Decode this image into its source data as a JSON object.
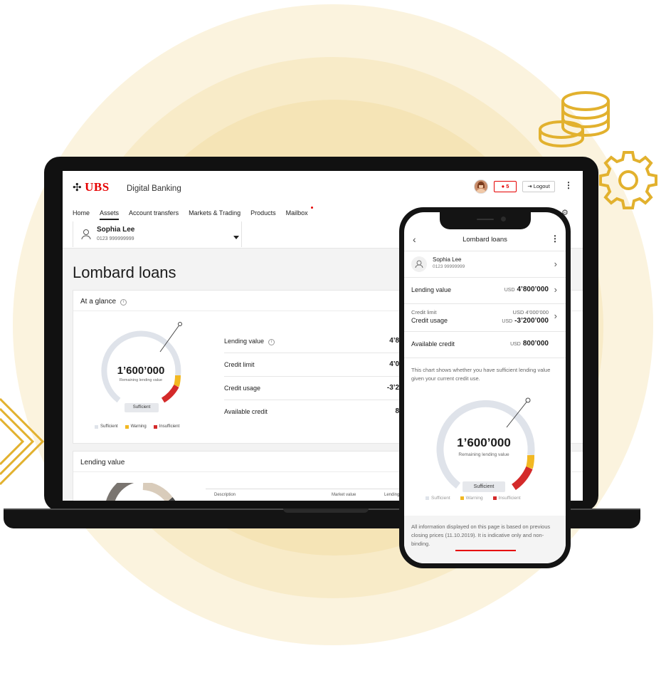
{
  "colors": {
    "brand_red": "#e60000",
    "sufficient": "#dfe3ea",
    "warning": "#f2b822",
    "insufficient": "#d42a2a",
    "accent_gold": "#e2b12e"
  },
  "app": {
    "logo_text": "UBS",
    "name": "Digital Banking"
  },
  "header": {
    "notification_count": "5",
    "logout_label": "Logout",
    "menu_icon": "kebab-icon"
  },
  "nav": {
    "items": [
      "Home",
      "Assets",
      "Account transfers",
      "Markets & Trading",
      "Products",
      "Mailbox"
    ],
    "active": "Assets"
  },
  "user": {
    "name": "Sophia Lee",
    "account": "0123 999999999"
  },
  "page": {
    "title": "Lombard loans"
  },
  "at_a_glance": {
    "title": "At a glance",
    "gauge": {
      "value": "1’600’000",
      "sublabel": "Remaining lending value",
      "status": "Sufficient",
      "fraction": 0.72
    },
    "legend": [
      "Sufficient",
      "Warning",
      "Insufficient"
    ],
    "rows": [
      {
        "label": "Lending value",
        "value": "4’800’"
      },
      {
        "label": "Credit limit",
        "value": "4’000’"
      },
      {
        "label": "Credit usage",
        "value": "-3’200’"
      },
      {
        "label": "Available credit",
        "value": "800’"
      }
    ]
  },
  "lending_value": {
    "title": "Lending value",
    "columns": [
      "Description",
      "Market value",
      "Lending"
    ]
  },
  "phone": {
    "title": "Lombard loans",
    "user": {
      "name": "Sophia Lee",
      "account": "0123 99999999"
    },
    "lending_value": {
      "label": "Lending value",
      "currency": "USD",
      "value": "4’800’000"
    },
    "credit_limit": {
      "label": "Credit limit",
      "value": "USD 4’000’000"
    },
    "credit_usage": {
      "label": "Credit usage",
      "currency": "USD",
      "value": "-3’200’000"
    },
    "available_credit": {
      "label": "Available credit",
      "currency": "USD",
      "value": "800’000"
    },
    "chart_description": "This chart shows whether you have sufficient lending value given your current credit use.",
    "gauge": {
      "value": "1’600’000",
      "sublabel": "Remaining lending value",
      "status": "Sufficient"
    },
    "legend": [
      "Sufficient",
      "Warning",
      "Insufficient"
    ],
    "disclaimer": "All information displayed on this page is based on previous closing prices (11.10.2019). It is indicative only and non-binding."
  }
}
